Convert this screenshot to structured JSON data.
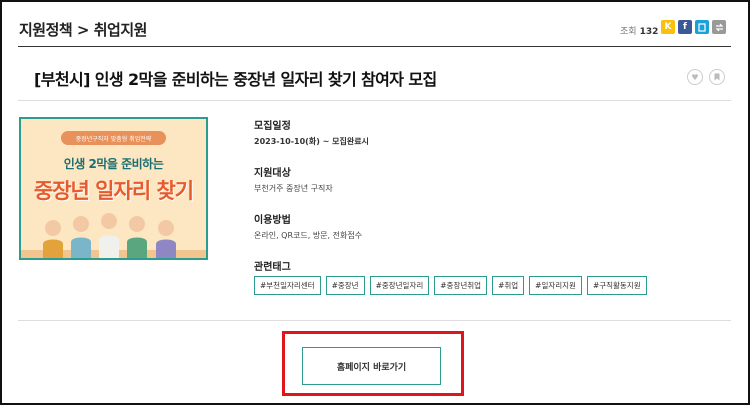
{
  "header": {
    "breadcrumb": "지원정책 > 취업지원",
    "views_label": "조회",
    "views_count": "132",
    "share_icons": [
      {
        "name": "kakaostory-icon",
        "glyph": "K",
        "color": "#f9c00c"
      },
      {
        "name": "facebook-icon",
        "glyph": "f",
        "color": "#3b5998"
      },
      {
        "name": "copy-icon",
        "glyph": "▯",
        "color": "#1ba1d9"
      },
      {
        "name": "share-icon",
        "glyph": "⇆",
        "color": "#999999"
      }
    ]
  },
  "post": {
    "title": "[부천시] 인생 2막을 준비하는 중장년 일자리 찾기 참여자 모집",
    "like_icon": "heart-icon",
    "bookmark_icon": "bookmark-icon"
  },
  "image": {
    "pill_text": "중장년구직자 맞춤형 취업전략",
    "line1": "인생 2막을 준비하는",
    "line2": "중장년 일자리 찾기"
  },
  "info": {
    "schedule_label": "모집일정",
    "schedule_value": "2023-10-10(화) ~ 모집완료시",
    "target_label": "지원대상",
    "target_value": "부천거주 중장년 구직자",
    "method_label": "이용방법",
    "method_value": "온라인, QR코드, 방문, 전화접수",
    "tags_label": "관련태그",
    "tags": [
      "#부천일자리센터",
      "#중장년",
      "#중장년일자리",
      "#중장년취업",
      "#취업",
      "#일자리지원",
      "#구직활동지원"
    ]
  },
  "action": {
    "homepage_label": "홈페이지 바로가기"
  },
  "colors": {
    "accent": "#2a9d8f",
    "highlight": "#e0141e"
  }
}
